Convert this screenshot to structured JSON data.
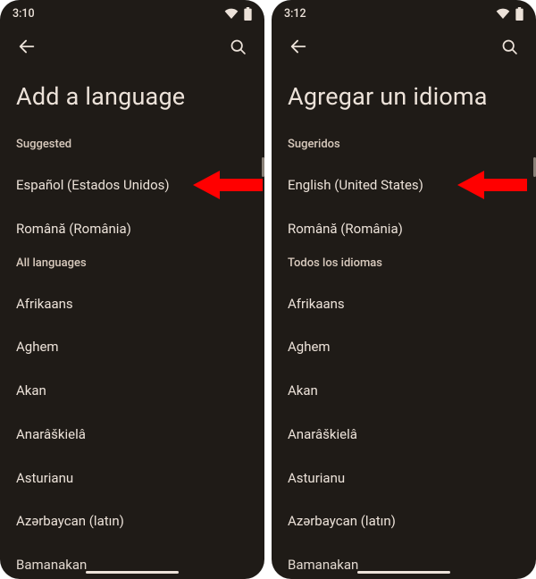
{
  "stage_bg": "#ffffff",
  "phone_bg": "#1f1b17",
  "text_color": "#ece2d9",
  "arrow_color": "#ff0000",
  "left": {
    "status": {
      "time": "3:10"
    },
    "title": "Add a language",
    "suggested_header": "Suggested",
    "suggested": [
      "Español (Estados Unidos)",
      "Română (România)"
    ],
    "all_header": "All languages",
    "all": [
      "Afrikaans",
      "Aghem",
      "Akan",
      "Anarâškielâ",
      "Asturianu",
      "Azərbaycan (latın)",
      "Bamanakan"
    ],
    "arrow_target_index": 0
  },
  "right": {
    "status": {
      "time": "3:12"
    },
    "title": "Agregar un idioma",
    "suggested_header": "Sugeridos",
    "suggested": [
      "English (United States)",
      "Română (România)"
    ],
    "all_header": "Todos los idiomas",
    "all": [
      "Afrikaans",
      "Aghem",
      "Akan",
      "Anarâškielâ",
      "Asturianu",
      "Azərbaycan (latın)",
      "Bamanakan"
    ],
    "arrow_target_index": 0
  }
}
